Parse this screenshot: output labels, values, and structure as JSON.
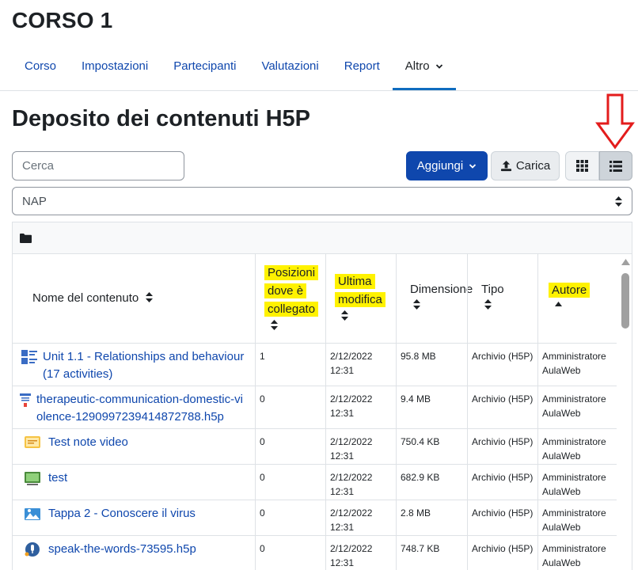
{
  "course": {
    "title": "CORSO 1"
  },
  "nav": {
    "tabs": [
      {
        "label": "Corso"
      },
      {
        "label": "Impostazioni"
      },
      {
        "label": "Partecipanti"
      },
      {
        "label": "Valutazioni"
      },
      {
        "label": "Report"
      },
      {
        "label": "Altro"
      }
    ],
    "active": "Altro"
  },
  "page": {
    "title": "Deposito dei contenuti H5P"
  },
  "toolbar": {
    "search_placeholder": "Cerca",
    "add_label": "Aggiungi",
    "upload_label": "Carica",
    "grid_view_icon": "grid-view-icon",
    "list_view_icon": "list-view-icon"
  },
  "context_select": {
    "value": "NAP"
  },
  "colors": {
    "link": "#0f47ad",
    "primary": "#0f47ad",
    "highlight": "#fff200",
    "annotation_arrow": "#e31c1c"
  },
  "table": {
    "headers": {
      "name": "Nome del contenuto",
      "usage_line1": "Posizioni",
      "usage_line2": "dove è",
      "usage_line3": "collegato",
      "modified_line1": "Ultima",
      "modified_line2": "modifica",
      "size": "Dimensione",
      "type": "Tipo",
      "author": "Autore"
    },
    "rows": [
      {
        "name_line1": "Unit 1.1 - Relationships and behaviour",
        "name_line2": "(17 activities)",
        "icon": "column-icon",
        "usage": "1",
        "modified_date": "2/12/2022",
        "modified_time": "12:31",
        "size": "95.8 MB",
        "type": "Archivio (H5P)",
        "author_line1": "Amministratore",
        "author_line2": "AulaWeb"
      },
      {
        "name_line1": "therapeutic-communication-domestic-vi",
        "name_line2": "olence-1290997239414872788.h5p",
        "icon": "interactive-book-icon",
        "usage": "0",
        "modified_date": "2/12/2022",
        "modified_time": "12:31",
        "size": "9.4 MB",
        "type": "Archivio (H5P)",
        "author_line1": "Amministratore",
        "author_line2": "AulaWeb"
      },
      {
        "name_line1": "Test note video",
        "name_line2": "",
        "icon": "interactive-video-icon",
        "usage": "0",
        "modified_date": "2/12/2022",
        "modified_time": "12:31",
        "size": "750.4 KB",
        "type": "Archivio (H5P)",
        "author_line1": "Amministratore",
        "author_line2": "AulaWeb"
      },
      {
        "name_line1": "test",
        "name_line2": "",
        "icon": "presentation-icon",
        "usage": "0",
        "modified_date": "2/12/2022",
        "modified_time": "12:31",
        "size": "682.9 KB",
        "type": "Archivio (H5P)",
        "author_line1": "Amministratore",
        "author_line2": "AulaWeb"
      },
      {
        "name_line1": "Tappa 2 - Conoscere il virus",
        "name_line2": "",
        "icon": "image-hotspots-icon",
        "usage": "0",
        "modified_date": "2/12/2022",
        "modified_time": "12:31",
        "size": "2.8 MB",
        "type": "Archivio (H5P)",
        "author_line1": "Amministratore",
        "author_line2": "AulaWeb"
      },
      {
        "name_line1": "speak-the-words-73595.h5p",
        "name_line2": "",
        "icon": "speak-the-words-icon",
        "usage": "0",
        "modified_date": "2/12/2022",
        "modified_time": "12:31",
        "size": "748.7 KB",
        "type": "Archivio (H5P)",
        "author_line1": "Amministratore",
        "author_line2": "AulaWeb"
      }
    ]
  }
}
